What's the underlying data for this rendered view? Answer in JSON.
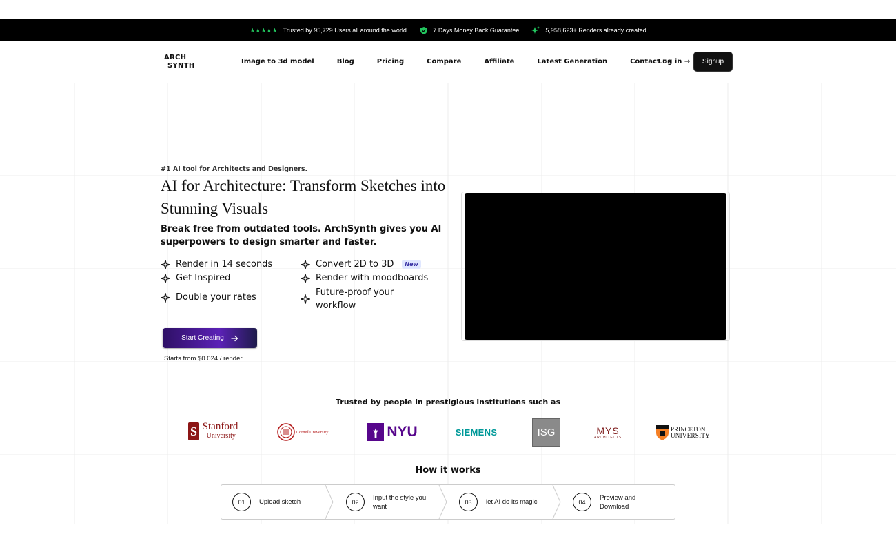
{
  "topbar": {
    "stars": "★★★★★",
    "trust_text": "Trusted by 95,729 Users all around the world.",
    "guarantee_text": "7 Days Money Back Guarantee",
    "renders_text": "5,958,623+ Renders already created",
    "accent_color": "#22c55e"
  },
  "nav": {
    "logo_line1": "ARCH",
    "logo_line2": "SYNTH",
    "links": [
      "Image to 3d model",
      "Blog",
      "Pricing",
      "Compare",
      "Affiliate",
      "Latest Generation",
      "Contact us"
    ],
    "login_label": "Log in →",
    "signup_label": "Signup"
  },
  "hero": {
    "kicker": "#1 AI tool for Architects and Designers.",
    "headline": "AI for Architecture: Transform Sketches into Stunning Visuals",
    "subhead": "Break free from outdated tools. ArchSynth gives you AI superpowers to design smarter and faster.",
    "features": [
      {
        "label": "Render in 14 seconds",
        "icon": "sparkle-icon"
      },
      {
        "label": "Convert 2D to 3D",
        "icon": "sparkle-icon",
        "badge": "New"
      },
      {
        "label": "Get Inspired",
        "icon": "sparkle-icon"
      },
      {
        "label": "Render with moodboards",
        "icon": "sparkle-icon"
      },
      {
        "label": "Double your rates",
        "icon": "sparkle-icon"
      },
      {
        "label": "Future-proof your workflow",
        "icon": "sparkle-icon"
      }
    ],
    "cta_label": "Start Creating",
    "price_note": "Starts from $0.024 / render"
  },
  "trusted": {
    "title": "Trusted by people in prestigious institutions such as",
    "logos": [
      {
        "name": "stanford",
        "line1": "Stanford",
        "line2": "University",
        "color": "#8c1515"
      },
      {
        "name": "cornell",
        "text": "CornellUniversity",
        "color": "#b31b1b"
      },
      {
        "name": "nyu",
        "text": "NYU",
        "color": "#57068c"
      },
      {
        "name": "siemens",
        "text": "SIEMENS",
        "color": "#009999"
      },
      {
        "name": "isg",
        "text": "ISG",
        "color": "#8a8a8a"
      },
      {
        "name": "mys",
        "line1": "MYS",
        "line2": "ARCHITECTS",
        "color": "#7f1d1d"
      },
      {
        "name": "princeton",
        "line1": "PRINCETON",
        "line2": "UNIVERSITY",
        "color": "#111111"
      }
    ]
  },
  "how": {
    "title": "How it works",
    "steps": [
      {
        "num": "01",
        "label": "Upload sketch"
      },
      {
        "num": "02",
        "label": "Input the style you want"
      },
      {
        "num": "03",
        "label": "let AI do its magic"
      },
      {
        "num": "04",
        "label": "Preview and Download"
      }
    ]
  }
}
